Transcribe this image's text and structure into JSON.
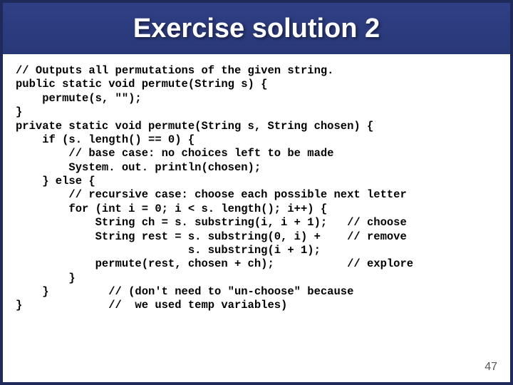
{
  "title": "Exercise solution 2",
  "page_number": "47",
  "code": "// Outputs all permutations of the given string.\npublic static void permute(String s) {\n    permute(s, \"\");\n}\nprivate static void permute(String s, String chosen) {\n    if (s. length() == 0) {\n        // base case: no choices left to be made\n        System. out. println(chosen);\n    } else {\n        // recursive case: choose each possible next letter\n        for (int i = 0; i < s. length(); i++) {\n            String ch = s. substring(i, i + 1);   // choose\n            String rest = s. substring(0, i) +    // remove\n                          s. substring(i + 1);\n            permute(rest, chosen + ch);           // explore\n        }\n    }         // (don't need to \"un-choose\" because\n}             //  we used temp variables)"
}
